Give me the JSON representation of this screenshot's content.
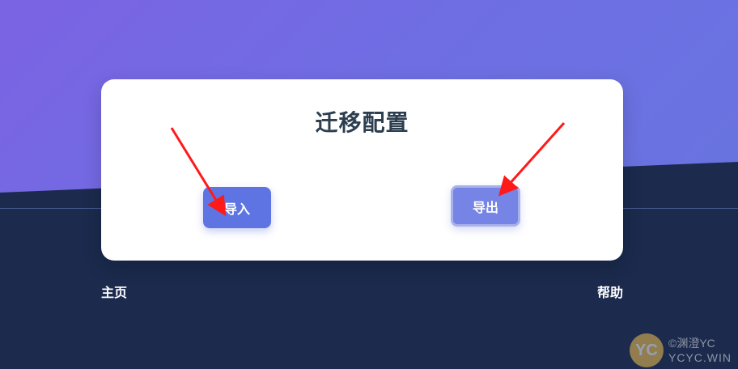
{
  "card": {
    "title": "迁移配置",
    "import_label": "导入",
    "export_label": "导出"
  },
  "footer": {
    "home_label": "主页",
    "help_label": "帮助"
  },
  "watermark": {
    "logo_text": "YC",
    "line1": "©渊澄YC",
    "line2": "YCYC.WIN"
  },
  "colors": {
    "gradient_start": "#7b63e3",
    "gradient_end": "#6874e0",
    "background_dark": "#1b2a4d",
    "button": "#5f74e3",
    "arrow": "#ff1a1a",
    "title": "#2c3e50"
  }
}
